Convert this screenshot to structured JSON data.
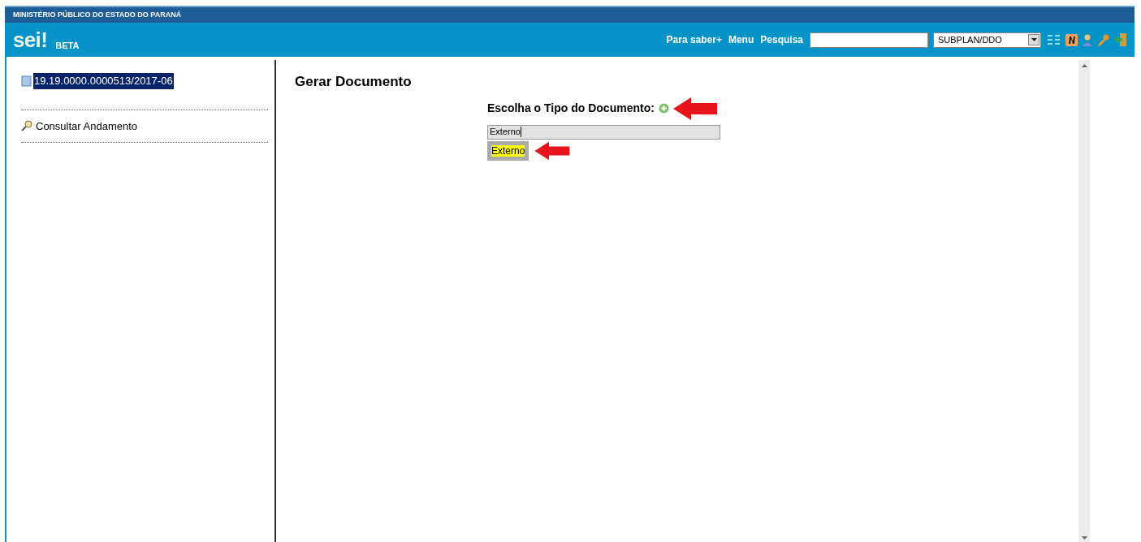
{
  "org_bar": {
    "title": "MINISTÉRIO PÚBLICO DO ESTADO DO PARANÁ"
  },
  "header": {
    "logo": "sei!",
    "badge": "BETA",
    "links": [
      "Para saber+",
      "Menu",
      "Pesquisa"
    ],
    "unit_select": {
      "value": "SUBPLAN/DDO"
    }
  },
  "sidebar": {
    "process": {
      "label": "19.19.0000.0000513/2017-06",
      "selected": true
    },
    "links": [
      "Consultar Andamento"
    ]
  },
  "content": {
    "title": "Gerar Documento",
    "label": "Escolha o Tipo do Documento:",
    "input": {
      "value": "Externo"
    },
    "suggestions": [
      {
        "label": "Externo",
        "selected": true
      }
    ]
  }
}
